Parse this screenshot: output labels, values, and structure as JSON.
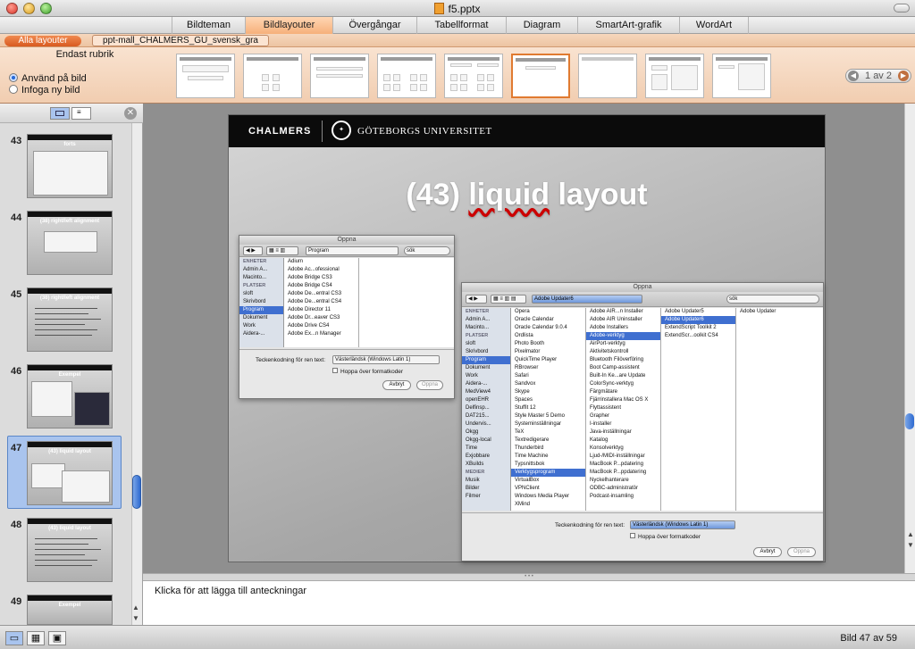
{
  "window": {
    "title": "f5.pptx"
  },
  "tabs": [
    "Bildteman",
    "Bildlayouter",
    "Övergångar",
    "Tabellformat",
    "Diagram",
    "SmartArt-grafik",
    "WordArt"
  ],
  "active_tab": "Bildlayouter",
  "gallery": {
    "all_layouts": "Alla layouter",
    "template": "ppt-mall_CHALMERS_GU_svensk_gra",
    "subtitle": "Endast rubrik",
    "radio_apply": "Använd på bild",
    "radio_insert": "Infoga ny bild",
    "pager": "1 av 2"
  },
  "thumbnails": [
    {
      "num": "43",
      "title": "forts"
    },
    {
      "num": "44",
      "title": "(38) right/left alignment"
    },
    {
      "num": "45",
      "title": "(38) right/left alignment"
    },
    {
      "num": "46",
      "title": "Exempel"
    },
    {
      "num": "47",
      "title": "(43) liquid layout"
    },
    {
      "num": "48",
      "title": "(43) liquid layout"
    },
    {
      "num": "49",
      "title": "Exempel"
    }
  ],
  "slide": {
    "logo1": "CHALMERS",
    "logo2": "GÖTEBORGS UNIVERSITET",
    "title_pre": "(43) ",
    "title_word": "liquid",
    "title_post": " layout"
  },
  "dialog_small": {
    "title": "Öppna",
    "location": "Program",
    "search": "sök",
    "sidebar": [
      "ENHETER",
      "Admin A...",
      "Macinto...",
      "PLATSER",
      "sloft",
      "Skrivbord",
      "Program",
      "Dokument",
      "Work",
      "Aidera-..."
    ],
    "sidebar_selected": "Program",
    "files": [
      "Adium",
      "Adobe Ac...ofessional",
      "Adobe Bridge CS3",
      "Adobe Bridge CS4",
      "Adobe De...entral CS3",
      "Adobe De...entral CS4",
      "Adobe Director 11",
      "Adobe Dr...eaver CS3",
      "Adobe Drive CS4",
      "Adobe Ex...n Manager"
    ],
    "encoding_label": "Teckenkodning för ren text:",
    "encoding_value": "Västerländsk (Windows Latin 1)",
    "checkbox": "Hoppa över formatkoder",
    "cancel": "Avbryt",
    "open": "Öppna"
  },
  "dialog_large": {
    "title": "Öppna",
    "location": "Adobe Updater6",
    "search": "sök",
    "sidebar": [
      "ENHETER",
      "Admin A...",
      "Macinto...",
      "PLATSER",
      "sloft",
      "Skrivbord",
      "Program",
      "Dokument",
      "Work",
      "Aidera-...",
      "MedView4",
      "openEHR",
      "Delfinsp...",
      "DAT215...",
      "Undervis...",
      "Okgg",
      "Okgg-local",
      "Time",
      "Exjobbare",
      "XBuilds",
      "MEDIER",
      "Musik",
      "Bilder",
      "Filmer"
    ],
    "sidebar_selected": "Program",
    "col1": [
      "Opera",
      "Oracle Calendar",
      "Oracle Calendar 9.0.4",
      "Ordlista",
      "Photo Booth",
      "Pixelmator",
      "QuickTime Player",
      "RBrowser",
      "Safari",
      "Sandvox",
      "Skype",
      "Spaces",
      "Stuffit 12",
      "Style Master 5 Demo",
      "Systeminställningar",
      "TeX",
      "Textredigerare",
      "Thunderbird",
      "Time Machine",
      "Typsnittsbok",
      "Verktygsprogram",
      "VirtualBox",
      "VPNClient",
      "Windows Media Player",
      "XMind"
    ],
    "col1_selected": "Verktygsprogram",
    "col2": [
      "Adobe AIR...n Installer",
      "Adobe AIR Uninstaller",
      "Adobe Installers",
      "Adobe-verktyg",
      "AirPort-verktyg",
      "Aktivitetskontroll",
      "Bluetooth Filöverföring",
      "Boot Camp-assistent",
      "Built-In Ke...are Update",
      "ColorSync-verktyg",
      "Färgmätare",
      "Fjärrinstallera Mac OS X",
      "Flyttassistent",
      "Grapher",
      "I-installer",
      "Java-inställningar",
      "Katalog",
      "Konsolverktyg",
      "Ljud-/MIDI-inställningar",
      "MacBook P...pdatering",
      "MacBook P...ppdatering",
      "Nyckelhanterare",
      "ODBC-administratör",
      "Podcast-insamling"
    ],
    "col2_selected": "Adobe-verktyg",
    "col3": [
      "Adobe Updater5",
      "Adobe Updater6",
      "ExtendScript Toolkit 2",
      "ExtendScr...oolkit CS4"
    ],
    "col3_selected": "Adobe Updater6",
    "col4": [
      "Adobe Updater"
    ],
    "encoding_label": "Teckenkodning för ren text:",
    "encoding_value": "Västerländsk (Windows Latin 1)",
    "checkbox": "Hoppa över formatkoder",
    "cancel": "Avbryt",
    "open": "Öppna"
  },
  "notes": {
    "placeholder": "Klicka för att lägga till anteckningar"
  },
  "status": {
    "slide_counter": "Bild 47 av 59"
  },
  "colors": {
    "accent": "#f08a50",
    "selection": "#a9c4ee",
    "slide_header": "#0b0b0b"
  }
}
